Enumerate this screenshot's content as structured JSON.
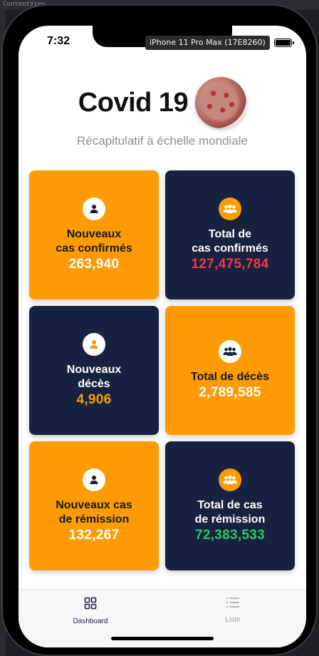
{
  "xcode": {
    "snippet": "ContentView"
  },
  "status_bar": {
    "time": "7:32"
  },
  "tooltip": "iPhone 11 Pro Max (17E8260)",
  "header": {
    "title": "Covid 19",
    "subtitle": "Récapitulatif à échelle mondiale"
  },
  "cards": [
    {
      "label": "Nouveaux\ncas confirmés",
      "value": "263,940",
      "value_color": "#ffffff",
      "theme": "orange",
      "icon": "person-icon"
    },
    {
      "label": "Total de\ncas confirmés",
      "value": "127,475,784",
      "value_color": "#f23b3b",
      "theme": "navy",
      "icon": "group-icon"
    },
    {
      "label": "Nouveaux\ndécès",
      "value": "4,906",
      "value_color": "#fe9b02",
      "theme": "navy",
      "icon": "person-icon"
    },
    {
      "label": "Total de décès",
      "value": "2,789,585",
      "value_color": "#ffffff",
      "theme": "orange",
      "icon": "group-icon"
    },
    {
      "label": "Nouveaux cas\nde rémission",
      "value": "132,267",
      "value_color": "#ffffff",
      "theme": "orange",
      "icon": "person-icon"
    },
    {
      "label": "Total de cas\nde rémission",
      "value": "72,383,533",
      "value_color": "#2ec55e",
      "theme": "navy",
      "icon": "group-icon"
    }
  ],
  "tabbar": {
    "tabs": [
      {
        "label": "Dashboard",
        "icon": "grid-icon",
        "active": true
      },
      {
        "label": "Liste",
        "icon": "list-icon",
        "active": false
      }
    ]
  },
  "colors": {
    "orange": "#fe9b02",
    "navy": "#172240",
    "active_tab": "#172240",
    "inactive_tab": "#a0a4ad"
  }
}
